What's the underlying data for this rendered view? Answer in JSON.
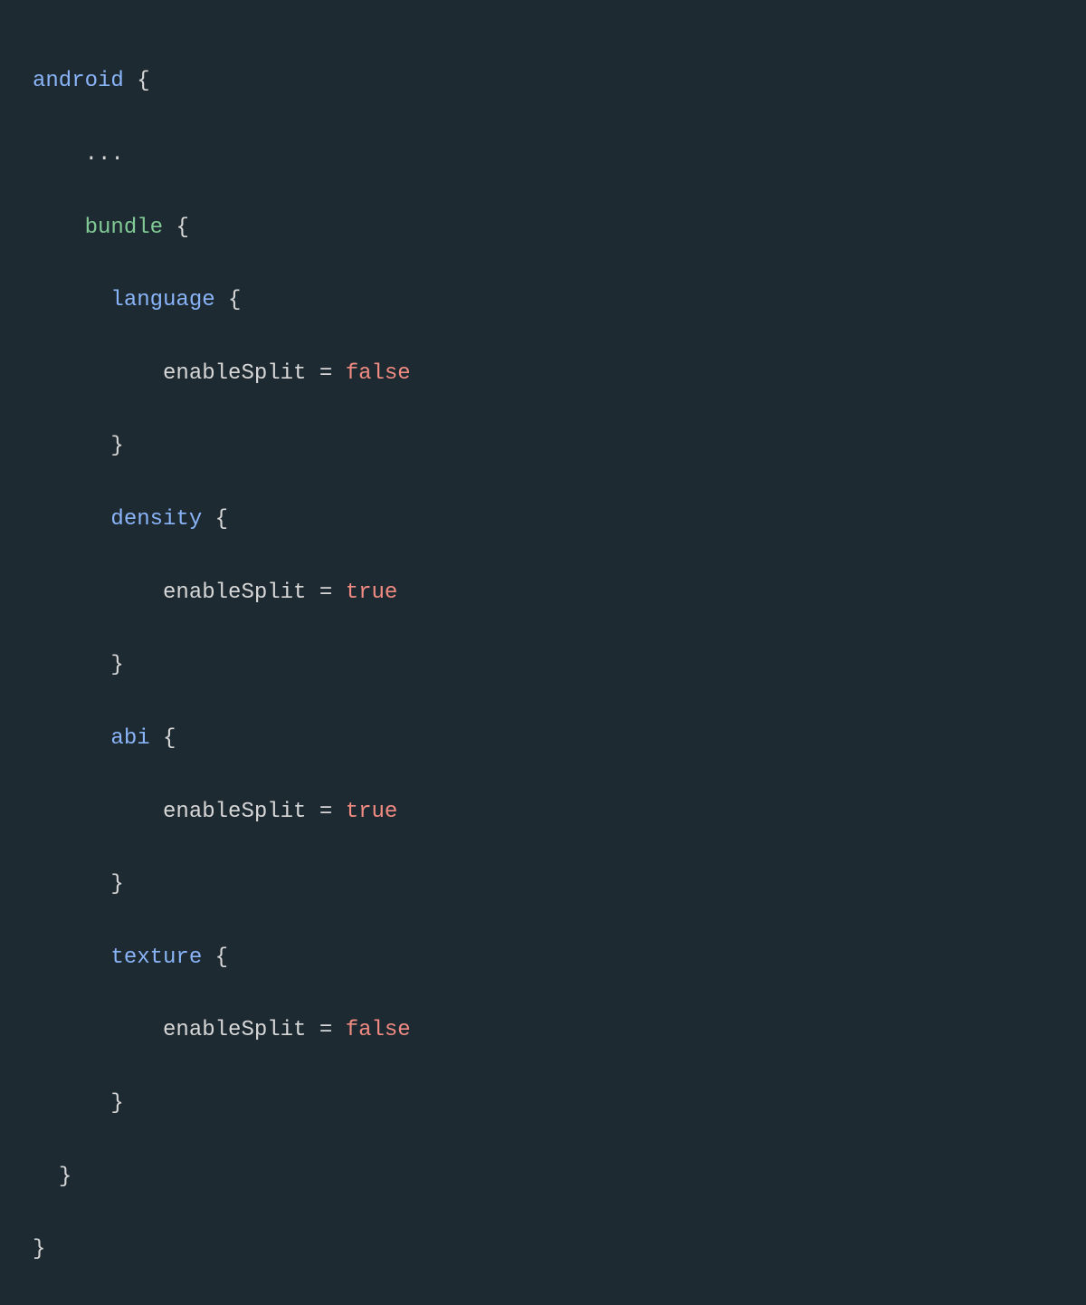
{
  "code": {
    "root_keyword": "android",
    "open_brace": "{",
    "close_brace": "}",
    "ellipsis": "...",
    "bundle_keyword": "bundle",
    "sections": {
      "language": {
        "name": "language",
        "prop": "enableSplit",
        "value": "false"
      },
      "density": {
        "name": "density",
        "prop": "enableSplit",
        "value": "true"
      },
      "abi": {
        "name": "abi",
        "prop": "enableSplit",
        "value": "true"
      },
      "texture": {
        "name": "texture",
        "prop": "enableSplit",
        "value": "false"
      }
    },
    "equals": " = "
  }
}
